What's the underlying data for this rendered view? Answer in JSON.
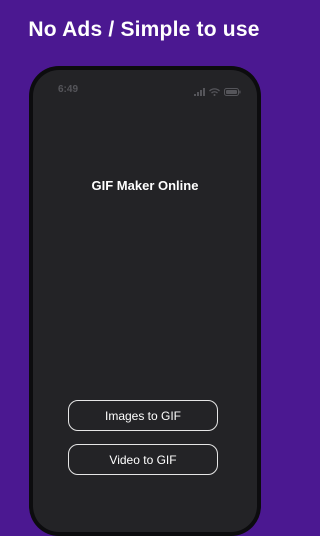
{
  "banner": {
    "text": "No Ads / Simple to use"
  },
  "status_bar": {
    "time": "6:49",
    "icons": [
      "signal-icon",
      "wifi-icon",
      "battery-icon"
    ]
  },
  "app": {
    "title": "GIF Maker Online"
  },
  "buttons": {
    "images_to_gif": "Images to GIF",
    "video_to_gif": "Video to GIF"
  },
  "colors": {
    "background": "#4b1891",
    "phone_frame": "#0c0c0e",
    "screen": "#232326",
    "button_border": "#e6e6e6"
  }
}
